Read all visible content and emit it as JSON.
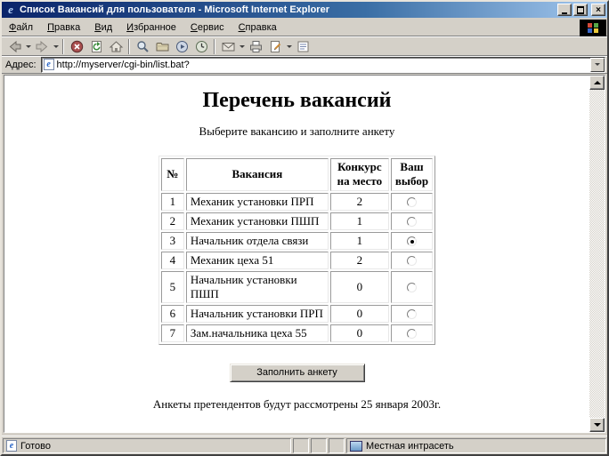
{
  "window": {
    "title": "Список Вакансий для пользователя - Microsoft Internet Explorer"
  },
  "menu": {
    "items": [
      "Файл",
      "Правка",
      "Вид",
      "Избранное",
      "Сервис",
      "Справка"
    ]
  },
  "toolbar": {
    "icons": [
      "back-icon",
      "back-dropdown",
      "forward-icon",
      "forward-dropdown",
      "stop-icon",
      "refresh-icon",
      "home-icon",
      "search-icon",
      "favorites-icon",
      "media-icon",
      "history-icon",
      "mail-icon",
      "mail-dropdown",
      "print-icon",
      "edit-icon",
      "edit-dropdown",
      "discuss-icon"
    ]
  },
  "address": {
    "label": "Адрес:",
    "value": "http://myserver/cgi-bin/list.bat?"
  },
  "page": {
    "title": "Перечень вакансий",
    "subtitle": "Выберите вакансию и заполните анкету",
    "table": {
      "headers": [
        "№",
        "Вакансия",
        "Конкурс на место",
        "Ваш выбор"
      ],
      "rows": [
        {
          "num": "1",
          "vacancy": "Механик установки ПРП",
          "competition": "2",
          "selected": false
        },
        {
          "num": "2",
          "vacancy": "Механик установки ПШП",
          "competition": "1",
          "selected": false
        },
        {
          "num": "3",
          "vacancy": "Начальник отдела связи",
          "competition": "1",
          "selected": true
        },
        {
          "num": "4",
          "vacancy": "Механик цеха 51",
          "competition": "2",
          "selected": false
        },
        {
          "num": "5",
          "vacancy": "Начальник установки ПШП",
          "competition": "0",
          "selected": false
        },
        {
          "num": "6",
          "vacancy": "Начальник установки ПРП",
          "competition": "0",
          "selected": false
        },
        {
          "num": "7",
          "vacancy": "Зам.начальника цеха 55",
          "competition": "0",
          "selected": false
        }
      ]
    },
    "button_label": "Заполнить анкету",
    "footer": "Анкеты претендентов будут рассмотрены 25 января 2003г."
  },
  "statusbar": {
    "ready": "Готово",
    "zone": "Местная интрасеть"
  },
  "colors": {
    "titlebar_start": "#0a246a",
    "titlebar_end": "#a6caf0",
    "chrome": "#d4d0c8",
    "page_background": "#ffffff"
  }
}
